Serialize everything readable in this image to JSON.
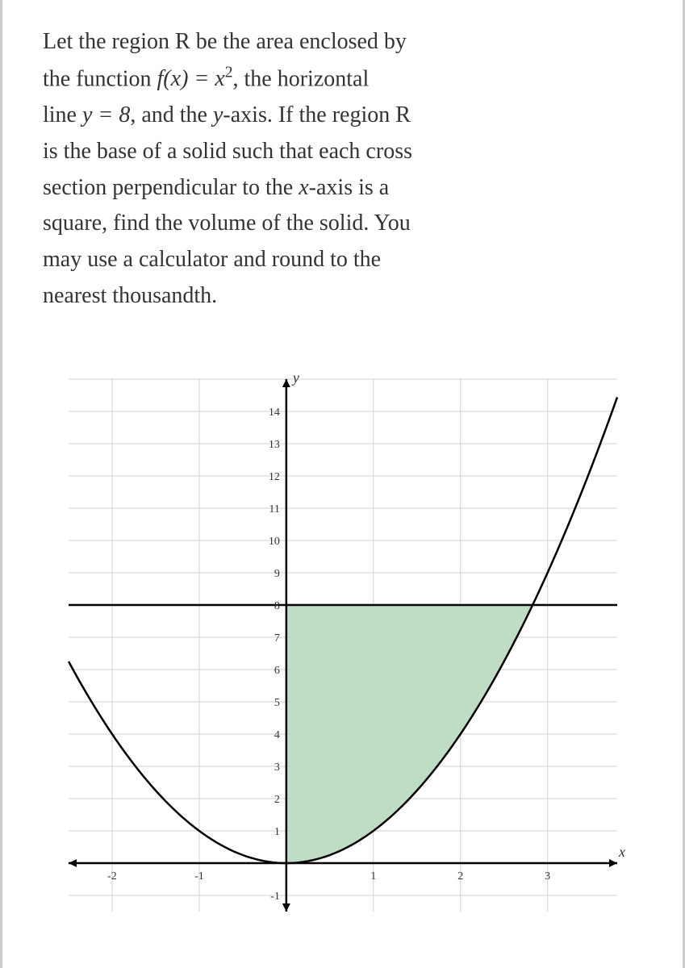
{
  "problem": {
    "line1": "Let the region R be the area enclosed by",
    "line2_a": "the function ",
    "line2_b": ", the horizontal",
    "line3_a": "line ",
    "line3_b": ", and the ",
    "line3_c": "-axis. If the region R",
    "line4": "is the base of a solid such that each cross",
    "line5": "section perpendicular to the ",
    "line5_b": "-axis is a",
    "line6": "square, find the volume of the solid. You",
    "line7": "may use a calculator and round to the",
    "line8": "nearest thousandth.",
    "f_expr": "f(x) = x²",
    "h_line": "y = 8",
    "y_var": "y",
    "x_var": "x"
  },
  "chart_data": {
    "type": "line",
    "title": "",
    "xlabel": "x",
    "ylabel": "y",
    "xlim": [
      -2.5,
      3.8
    ],
    "ylim": [
      -1.5,
      15
    ],
    "grid": true,
    "x_ticks": [
      -2,
      -1,
      1,
      2,
      3
    ],
    "y_ticks": [
      -1,
      1,
      2,
      3,
      4,
      5,
      6,
      7,
      8,
      9,
      10,
      11,
      12,
      13,
      14
    ],
    "series": [
      {
        "name": "f(x)=x^2",
        "x": [
          -2.5,
          -2,
          -1.5,
          -1,
          -0.5,
          0,
          0.5,
          1,
          1.5,
          2,
          2.5,
          2.83,
          3,
          3.5,
          3.8
        ],
        "values": [
          6.25,
          4,
          2.25,
          1,
          0.25,
          0,
          0.25,
          1,
          2.25,
          4,
          6.25,
          8,
          9,
          12.25,
          14.44
        ]
      },
      {
        "name": "y=8",
        "x": [
          -2.5,
          3.8
        ],
        "values": [
          8,
          8
        ]
      }
    ],
    "region": {
      "description": "Region R enclosed by f(x)=x^2, y=8, y-axis (x>=0)",
      "vertices_approx": [
        [
          0,
          0
        ],
        [
          0,
          8
        ],
        [
          2.828,
          8
        ]
      ],
      "bounded_by": [
        "y-axis",
        "y=8",
        "y=x^2"
      ]
    }
  }
}
